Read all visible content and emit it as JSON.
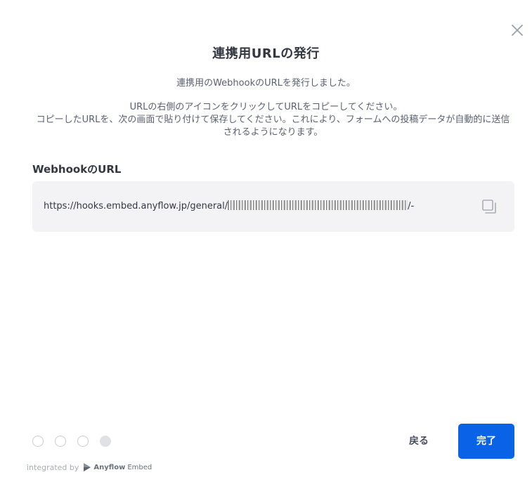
{
  "dialog": {
    "title": "連携用URLの発行",
    "description_1": "連携用のWebhookのURLを発行しました。",
    "description_2": "URLの右側のアイコンをクリックしてURLをコピーしてください。",
    "description_3": "コピーしたURLを、次の画面で貼り付けて保存してください。これにより、フォームへの投稿データが自動的に送信されるようになります。"
  },
  "webhook": {
    "label": "WebhookのURL",
    "url_prefix": "https://hooks.embed.anyflow.jp/general/",
    "url_suffix": "/-"
  },
  "steps": {
    "total": 4,
    "current": 4
  },
  "actions": {
    "back_label": "戻る",
    "done_label": "完了"
  },
  "footer": {
    "integrated_by": "integrated by",
    "brand": "Anyflow",
    "brand_sub": "Embed"
  },
  "colors": {
    "primary": "#0a63e6",
    "url_box_bg": "#f3f3f5"
  },
  "icons": {
    "close": "close-icon",
    "copy": "copy-icon",
    "brand_logo": "anyflow-logo-icon"
  }
}
